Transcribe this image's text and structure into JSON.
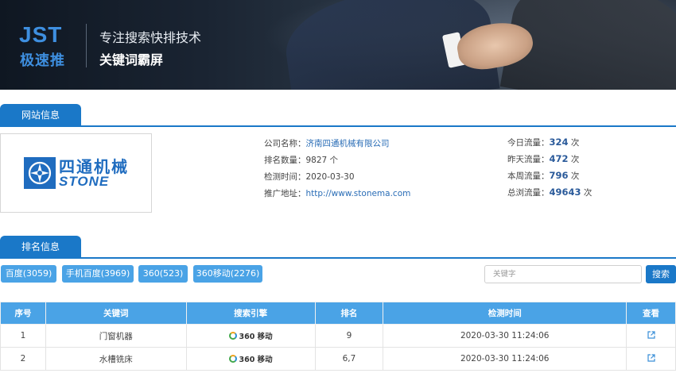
{
  "banner": {
    "logo_main": "JST",
    "logo_sub": "极速推",
    "slogan_line1": "专注搜索快排技术",
    "slogan_line2": "关键词霸屏"
  },
  "site_section": {
    "tab_label": "网站信息",
    "company_logo": {
      "cn": "四通机械",
      "en": "STONE"
    },
    "company_name_label": "公司名称：",
    "company_name": "济南四通机械有限公司",
    "rank_count_label": "排名数量：",
    "rank_count": "9827 个",
    "check_time_label": "检测时间：",
    "check_time": "2020-03-30",
    "promo_url_label": "推广地址：",
    "promo_url": "http://www.stonema.com",
    "today_label": "今日流量：",
    "today_value": "324",
    "yesterday_label": "昨天流量：",
    "yesterday_value": "472",
    "week_label": "本周流量：",
    "week_value": "796",
    "total_label": "总浏流量：",
    "total_value": "49643",
    "unit": "次"
  },
  "rank_section": {
    "tab_label": "排名信息",
    "filters": [
      "百度(3059)",
      "手机百度(3969)",
      "360(523)",
      "360移动(2276)"
    ],
    "search_placeholder": "关键字",
    "search_button": "搜索"
  },
  "table": {
    "headers": [
      "序号",
      "关键词",
      "搜索引擎",
      "排名",
      "检测时间",
      "查看"
    ],
    "engine_label": "360 移动",
    "rows": [
      {
        "index": "1",
        "keyword": "门窗机器",
        "rank": "9",
        "time": "2020-03-30 11:24:06"
      },
      {
        "index": "2",
        "keyword": "水槽铣床",
        "rank": "6,7",
        "time": "2020-03-30 11:24:06"
      }
    ]
  },
  "colors": {
    "primary": "#1a78c8",
    "button": "#4aa3e6",
    "link": "#2a6db6"
  }
}
